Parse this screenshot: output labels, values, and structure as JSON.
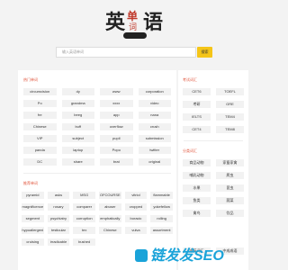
{
  "logo": {
    "char1": "英",
    "char2": "单",
    "char2b": "词",
    "char3": "语"
  },
  "search": {
    "placeholder": "输入英语单词",
    "button": "搜索"
  },
  "hot": {
    "title": "热门单词",
    "words": [
      "circumcision",
      "dy",
      "www",
      "corporation",
      "Po",
      "grandma",
      "xxxx",
      "video",
      "fre",
      "beeg",
      "app",
      "nana",
      "Chinese",
      "buff",
      "overflow",
      "crush",
      "VIP",
      "subject",
      "pupil",
      "submission",
      "panda",
      "laptop",
      "Popo",
      "twitter",
      "DC",
      "share",
      "brat",
      "original"
    ]
  },
  "recommended": {
    "title": "推荐单词",
    "words": [
      "pyramid",
      "asks",
      "MSG",
      "OFCOURSE",
      "vitriol",
      "flammable",
      "magnificence",
      "rosary",
      "comparer",
      "abuser",
      "cropped",
      "yokefellow",
      "segment",
      "psychiatry",
      "corruption",
      "emphatically",
      "boracic",
      "rolling",
      "hypoallergeni",
      "testicular",
      "tex",
      "Chinese",
      "vulva",
      "assortment",
      "cruising",
      "irradicable",
      "bushed",
      "",
      "",
      ""
    ]
  },
  "exam": {
    "title": "考试词汇",
    "items": [
      "CET6",
      "TOEFL",
      "考研",
      "GRE",
      "IELTS",
      "TEM4",
      "CET4",
      "TEM8"
    ]
  },
  "category": {
    "title": "分类词汇",
    "items": [
      "商品动物",
      "家畜家禽",
      "哺乳动物",
      "爬虫",
      "水果",
      "昆虫",
      "鱼类",
      "蔬菜",
      "禽鸟",
      "饮品",
      "",
      "",
      "",
      "",
      "中英词汇",
      "中成成语"
    ]
  },
  "watermark": {
    "prefix": "Ai",
    "text": "链发发SEO"
  }
}
